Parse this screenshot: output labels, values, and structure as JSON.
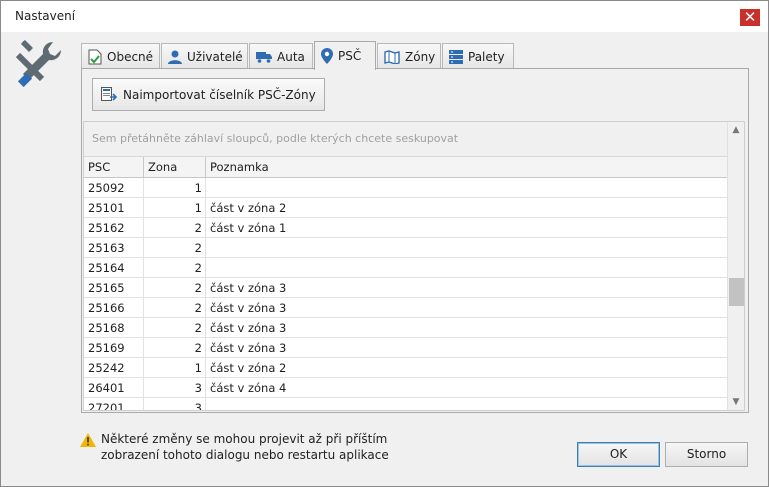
{
  "window": {
    "title": "Nastavení"
  },
  "tabs": [
    {
      "label": "Obecné",
      "icon": "document-check-icon"
    },
    {
      "label": "Uživatelé",
      "icon": "user-icon"
    },
    {
      "label": "Auta",
      "icon": "truck-icon"
    },
    {
      "label": "PSČ",
      "icon": "map-pin-icon",
      "active": true
    },
    {
      "label": "Zóny",
      "icon": "map-icon"
    },
    {
      "label": "Palety",
      "icon": "server-icon"
    }
  ],
  "import_button": {
    "label": "Naimportovat číselník PSČ-Zóny"
  },
  "grid": {
    "group_hint": "Sem přetáhněte záhlaví sloupců, podle kterých chcete seskupovat",
    "columns": [
      "PSC",
      "Zona",
      "Poznamka"
    ],
    "rows": [
      [
        "25092",
        "1",
        ""
      ],
      [
        "25101",
        "1",
        "část v zóna 2"
      ],
      [
        "25162",
        "2",
        "část v zóna 1"
      ],
      [
        "25163",
        "2",
        ""
      ],
      [
        "25164",
        "2",
        ""
      ],
      [
        "25165",
        "2",
        "část v zóna 3"
      ],
      [
        "25166",
        "2",
        "část v zóna 3"
      ],
      [
        "25168",
        "2",
        "část v zóna 3"
      ],
      [
        "25169",
        "2",
        "část v zóna 3"
      ],
      [
        "25242",
        "1",
        "část v zóna 2"
      ],
      [
        "26401",
        "3",
        "část v zóna 4"
      ],
      [
        "27201",
        "3",
        ""
      ]
    ]
  },
  "warning": {
    "line1": "Některé změny se mohou projevit až při příštím",
    "line2": "zobrazení tohoto dialogu nebo restartu aplikace"
  },
  "buttons": {
    "ok": "OK",
    "cancel": "Storno"
  },
  "colors": {
    "accent": "#2f6db3",
    "close": "#c9302c"
  }
}
